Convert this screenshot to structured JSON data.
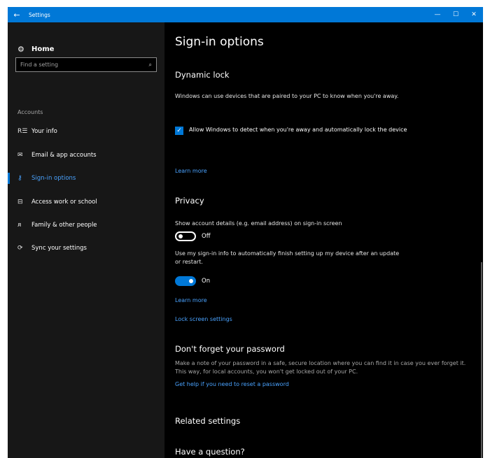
{
  "window": {
    "title": "Settings",
    "back_glyph": "←",
    "minimize_glyph": "—",
    "maximize_glyph": "☐",
    "close_glyph": "✕",
    "titlebar_color": "#0078d7"
  },
  "sidebar": {
    "home_label": "Home",
    "search_placeholder": "Find a setting",
    "group_label": "Accounts",
    "items": [
      {
        "label": "Your info",
        "icon": "person-card-icon",
        "glyph": "R☰"
      },
      {
        "label": "Email & app accounts",
        "icon": "mail-icon",
        "glyph": "✉"
      },
      {
        "label": "Sign-in options",
        "icon": "key-icon",
        "glyph": "⚷",
        "active": true
      },
      {
        "label": "Access work or school",
        "icon": "briefcase-icon",
        "glyph": "⊟"
      },
      {
        "label": "Family & other people",
        "icon": "people-icon",
        "glyph": "ᴙ"
      },
      {
        "label": "Sync your settings",
        "icon": "sync-icon",
        "glyph": "⟳"
      }
    ]
  },
  "main": {
    "title": "Sign-in options",
    "dynamic_lock": {
      "heading": "Dynamic lock",
      "description": "Windows can use devices that are paired to your PC to know when you're away.",
      "checkbox_label": "Allow Windows to detect when you're away and automatically lock the device",
      "checkbox_checked": true,
      "learn_more": "Learn more"
    },
    "privacy": {
      "heading": "Privacy",
      "account_details_label": "Show account details (e.g. email address) on sign-in screen",
      "account_details_state": "Off",
      "signin_info_label": "Use my sign-in info to automatically finish setting up my device after an update or restart.",
      "signin_info_state": "On",
      "learn_more": "Learn more",
      "lock_screen_link": "Lock screen settings"
    },
    "password": {
      "heading": "Don't forget your password",
      "description": "Make a note of your password in a safe, secure location where you can find it in case you ever forget it. This way, for local accounts, you won't get locked out of your PC.",
      "help_link": "Get help if you need to reset a password"
    },
    "related_heading": "Related settings",
    "question_heading": "Have a question?"
  },
  "colors": {
    "accent": "#0078d7",
    "link": "#4aa3ff",
    "background": "#000000",
    "sidebar": "#171717"
  }
}
